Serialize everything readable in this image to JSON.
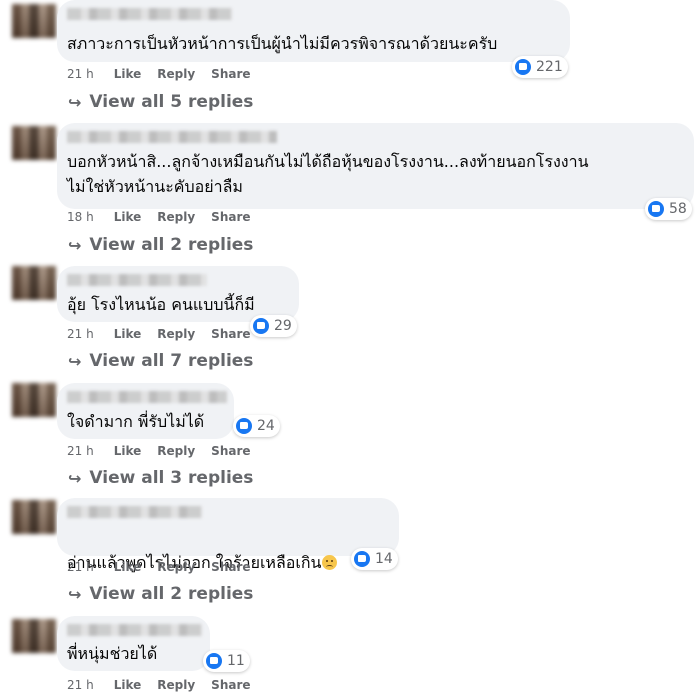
{
  "comments": [
    {
      "text": "สภาวะการเป็นหัวหน้าการเป็นผู้นำไม่มีควรพิจารณาด้วยนะครับ",
      "reactions": "221",
      "time": "21 h",
      "like": "Like",
      "reply": "Reply",
      "share": "Share",
      "view_replies": "View all 5 replies"
    },
    {
      "text": "บอกหัวหน้าสิ...ลูกจ้างเหมือนกันไม่ได้ถือหุ้นของโรงงาน...ลงท้ายนอกโรงงาน\nไม่ใช่หัวหน้านะคับอย่าลืม",
      "reactions": "58",
      "time": "18 h",
      "like": "Like",
      "reply": "Reply",
      "share": "Share",
      "view_replies": "View all 2 replies"
    },
    {
      "text": "อุ้ย โรงไหนน้อ คนแบบนี้ก็มี",
      "reactions": "29",
      "time": "21 h",
      "like": "Like",
      "reply": "Reply",
      "share": "Share",
      "view_replies": "View all 7 replies"
    },
    {
      "text": "ใจดำมาก พี่รับไม่ได้",
      "reactions": "24",
      "time": "21 h",
      "like": "Like",
      "reply": "Reply",
      "share": "Share",
      "view_replies": "View all 3 replies"
    },
    {
      "text": "อ่านแล้วพูดไรไม่ออก ใจร้ายเหลือเกิน",
      "emoji": "sad-face",
      "reactions": "14",
      "time": "21 h",
      "like": "Like",
      "reply": "Reply",
      "share": "Share",
      "view_replies": "View all 2 replies"
    },
    {
      "text": "พี่หนุ่มช่วยได้",
      "reactions": "11",
      "time": "21 h",
      "like": "Like",
      "reply": "Reply",
      "share": "Share"
    }
  ],
  "colors": {
    "bubble": "#f0f2f5",
    "like_blue": "#1877f2",
    "meta_gray": "#65676b"
  }
}
